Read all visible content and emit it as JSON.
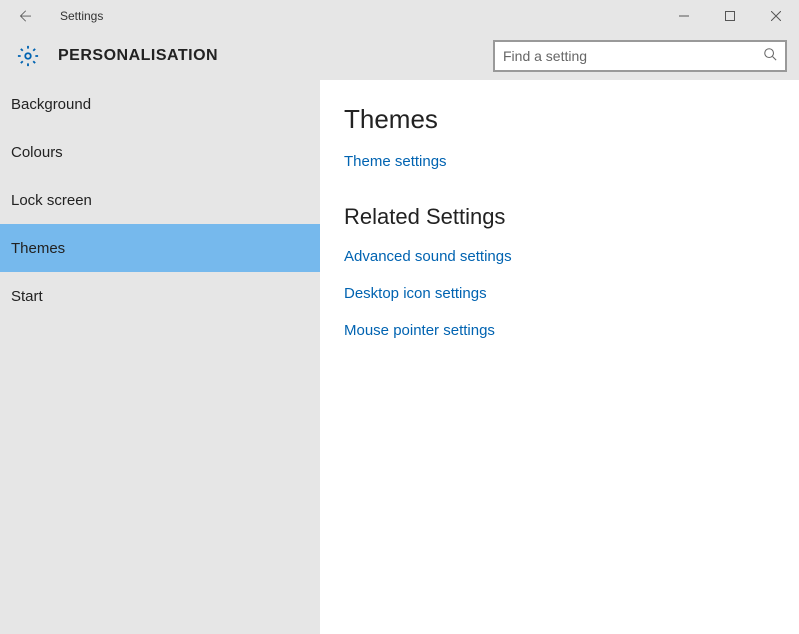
{
  "window": {
    "title": "Settings"
  },
  "header": {
    "page_title": "PERSONALISATION",
    "search_placeholder": "Find a setting"
  },
  "sidebar": {
    "items": [
      {
        "label": "Background",
        "selected": false
      },
      {
        "label": "Colours",
        "selected": false
      },
      {
        "label": "Lock screen",
        "selected": false
      },
      {
        "label": "Themes",
        "selected": true
      },
      {
        "label": "Start",
        "selected": false
      }
    ]
  },
  "content": {
    "heading": "Themes",
    "links_primary": [
      "Theme settings"
    ],
    "related_heading": "Related Settings",
    "links_related": [
      "Advanced sound settings",
      "Desktop icon settings",
      "Mouse pointer settings"
    ]
  }
}
